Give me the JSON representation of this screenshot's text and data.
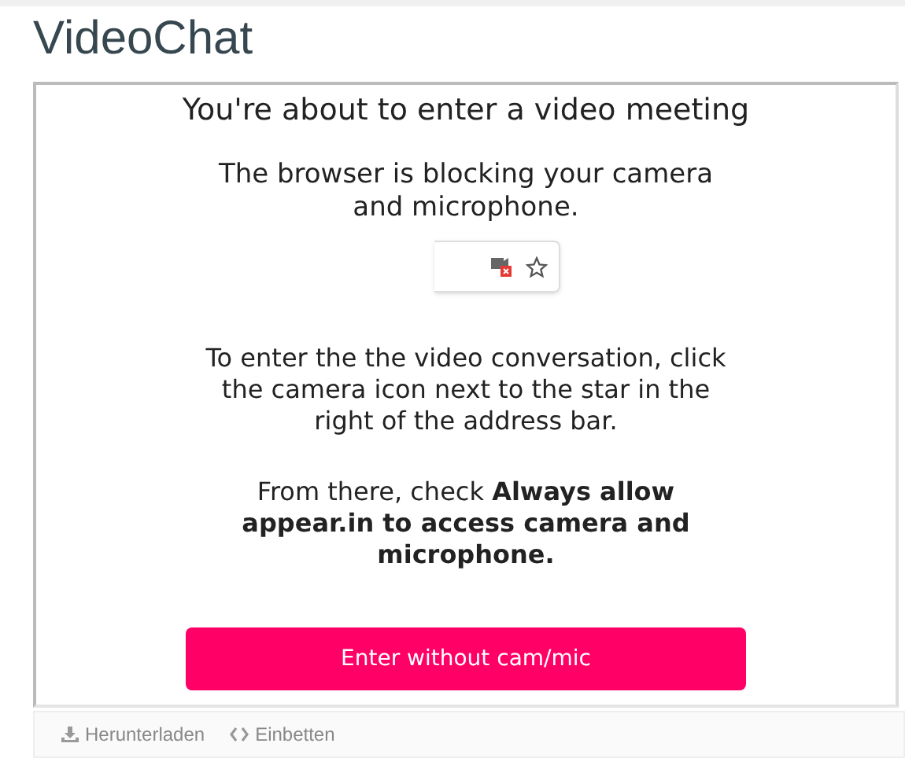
{
  "title": "VideoChat",
  "heading": "You're about to enter a video meeting",
  "blocked_message": "The browser is blocking your camera and microphone.",
  "instructions": "To enter the the video conversation, click the camera icon next to the star in the right of the address bar.",
  "allow_hint": "From there, check **Always allow appear.in to access camera and microphone.**",
  "button": "Enter without cam/mic",
  "footer_links": [
    {
      "label": "Herunterladen",
      "kind": "download"
    },
    {
      "label": "Einbetten",
      "kind": "embed"
    }
  ]
}
